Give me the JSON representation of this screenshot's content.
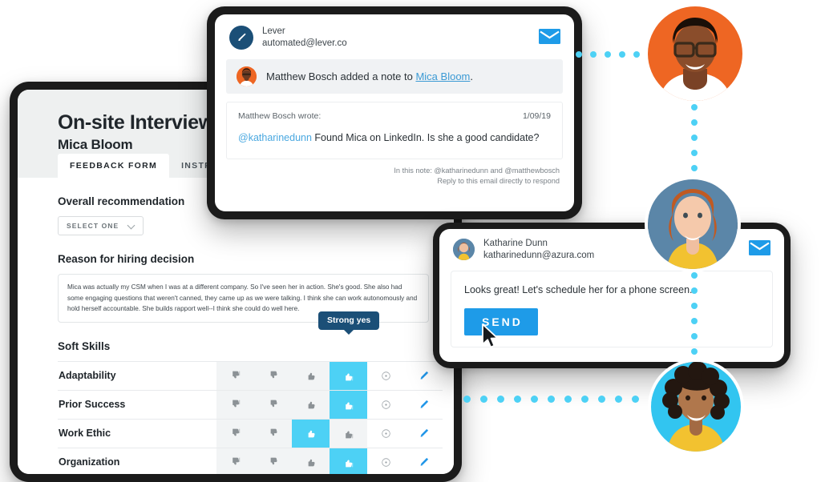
{
  "feedback_form": {
    "title": "On-site Interview",
    "candidate": "Mica Bloom",
    "tabs": [
      {
        "label": "FEEDBACK FORM",
        "active": true
      },
      {
        "label": "INSTRUCTIONS",
        "active": false
      }
    ],
    "overall_recommendation_label": "Overall recommendation",
    "select_placeholder": "SELECT ONE",
    "reason_label": "Reason for hiring decision",
    "reason_text": "Mica was actually my CSM when I was at a different company. So I've seen her in action. She's good. She also had some engaging questions that weren't canned, they came up as we were talking. I think she can work autonomously and hold herself accountable. She builds rapport well--I think she could do well here.",
    "soft_skills_label": "Soft Skills",
    "tooltip": "Strong yes",
    "rating_columns": [
      "strong-no",
      "no",
      "yes",
      "strong-yes",
      "no-opinion",
      "comment"
    ],
    "rows": [
      {
        "skill": "Adaptability",
        "selected": 3
      },
      {
        "skill": "Prior Success",
        "selected": 3
      },
      {
        "skill": "Work Ethic",
        "selected": 2
      },
      {
        "skill": "Organization",
        "selected": 3
      }
    ]
  },
  "notification_card": {
    "sender_name": "Lever",
    "sender_email": "automated@lever.co",
    "logo_icon": "lever-pen-icon",
    "envelope_icon": "envelope-icon",
    "banner_prefix": "Matthew Bosch added a note to ",
    "banner_link": "Mica Bloom",
    "banner_suffix": ".",
    "wrote_by": "Matthew Bosch wrote:",
    "date": "1/09/19",
    "note_mention": "@katharinedunn",
    "note_body": " Found Mica on LinkedIn. Is she a good candidate?",
    "footer_line1": "In this note: @katharinedunn and @matthewbosch",
    "footer_line2": "Reply to this email directly to respond"
  },
  "reply_card": {
    "sender_name": "Katharine Dunn",
    "sender_email": "katharinedunn@azura.com",
    "envelope_icon": "envelope-icon",
    "message": "Looks great! Let's schedule her for a phone screen.",
    "send_label": "SEND",
    "cursor_icon": "mouse-pointer-icon"
  },
  "avatars": [
    {
      "name": "matthew-bosch-avatar",
      "bg": "#ee6623"
    },
    {
      "name": "katharine-dunn-avatar",
      "bg": "#5b86a8"
    },
    {
      "name": "mica-bloom-avatar",
      "bg": "#32c5f0"
    }
  ],
  "colors": {
    "accent_cyan": "#4dd1f5",
    "accent_blue": "#1e9be8",
    "navy": "#1b4f77",
    "link": "#3b9ad4",
    "panel_gray": "#f2f4f5"
  }
}
